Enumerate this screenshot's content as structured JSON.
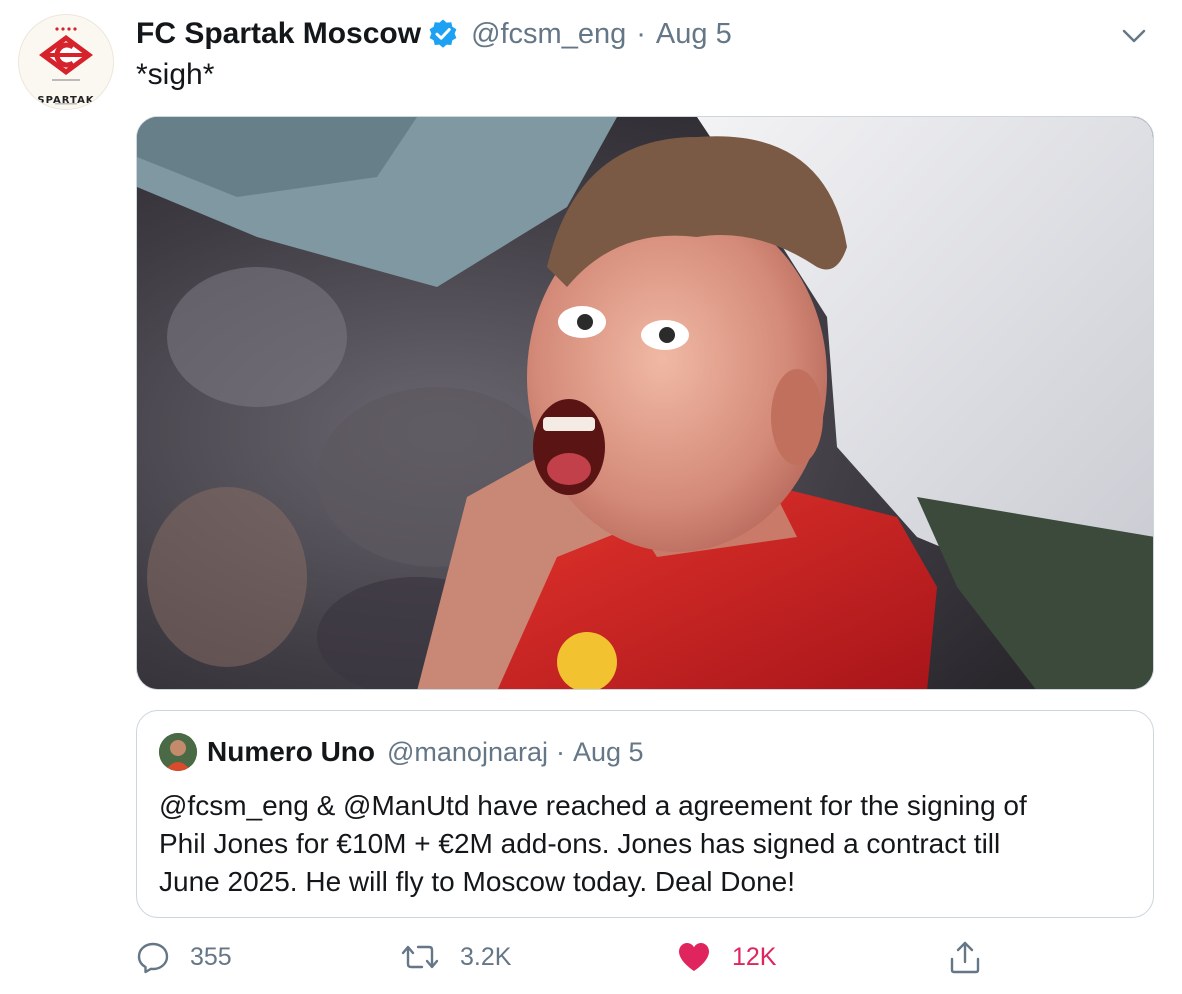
{
  "tweet": {
    "display_name": "FC Spartak Moscow",
    "handle": "@fcsm_eng",
    "separator": "·",
    "date": "Aug 5",
    "text": "*sigh*",
    "avatar_label": "SPARTAK"
  },
  "quoted_tweet": {
    "display_name": "Numero Uno",
    "handle": "@manojnaraj",
    "separator": "·",
    "date": "Aug 5",
    "text_lines": [
      "@fcsm_eng & @ManUtd have reached a agreement for the signing of",
      "Phil Jones for €10M + €2M add-ons. Jones has signed a contract till",
      "June 2025. He will fly to Moscow today. Deal Done!"
    ]
  },
  "actions": {
    "reply_count": "355",
    "retweet_count": "3.2K",
    "like_count": "12K",
    "liked": true
  },
  "icons": {
    "verified": "verified-badge-icon",
    "caret": "chevron-down-icon",
    "reply": "reply-icon",
    "retweet": "retweet-icon",
    "like": "heart-icon",
    "share": "share-icon"
  },
  "colors": {
    "text_primary": "#14171a",
    "text_secondary": "#657786",
    "verified_blue": "#1da1f2",
    "like_red": "#e0245e",
    "border": "#ccd6dd",
    "spartak_red": "#d6222a"
  }
}
